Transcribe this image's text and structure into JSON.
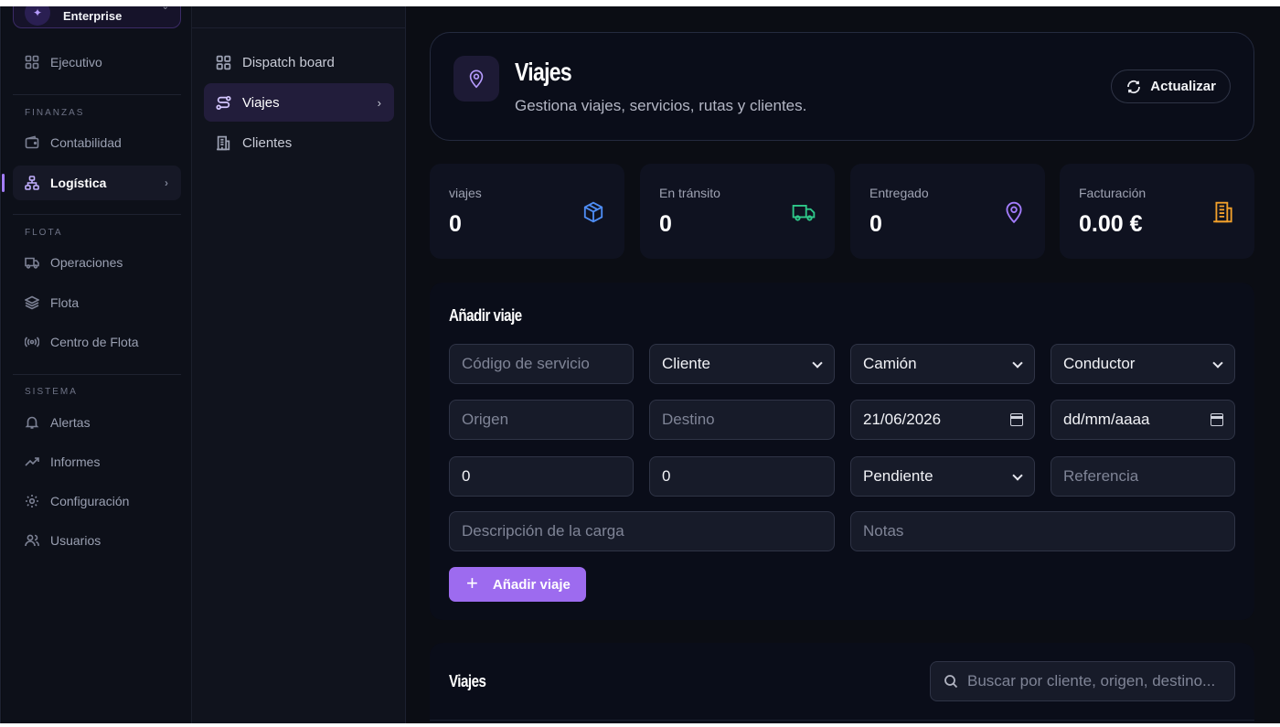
{
  "sidebar": {
    "org_name": "Enterprise",
    "items": {
      "ejecutivo": "Ejecutivo",
      "contabilidad": "Contabilidad",
      "logistica": "Logística",
      "operaciones": "Operaciones",
      "flota": "Flota",
      "centro_flota": "Centro de Flota",
      "alertas": "Alertas",
      "informes": "Informes",
      "configuracion": "Configuración",
      "usuarios": "Usuarios"
    },
    "sections": {
      "finanzas": "FINANZAS",
      "flota": "FLOTA",
      "sistema": "SISTEMA"
    }
  },
  "subnav": {
    "dispatch": "Dispatch board",
    "viajes": "Viajes",
    "clientes": "Clientes"
  },
  "header": {
    "title": "Viajes",
    "subtitle": "Gestiona viajes, servicios, rutas y clientes.",
    "refresh_label": "Actualizar"
  },
  "stats": [
    {
      "label": "viajes",
      "value": "0",
      "icon": "box-icon",
      "color": "#4e8df5"
    },
    {
      "label": "En tránsito",
      "value": "0",
      "icon": "truck-icon",
      "color": "#2fc98a"
    },
    {
      "label": "Entregado",
      "value": "0",
      "icon": "map-pin-icon",
      "color": "#a47dff"
    },
    {
      "label": "Facturación",
      "value": "0.00 €",
      "icon": "building-icon",
      "color": "#f3a12b"
    }
  ],
  "form": {
    "title": "Añadir viaje",
    "service_code_placeholder": "Código de servicio",
    "client_select": "Cliente",
    "truck_select": "Camión",
    "driver_select": "Conductor",
    "origin_placeholder": "Origen",
    "destination_placeholder": "Destino",
    "date_start": "21/06/2026",
    "date_end_placeholder": "dd/mm/aaaa",
    "amount_1": "0",
    "amount_2": "0",
    "status_select": "Pendiente",
    "reference_placeholder": "Referencia",
    "cargo_placeholder": "Descripción de la carga",
    "notes_placeholder": "Notas",
    "submit_label": "Añadir viaje"
  },
  "list": {
    "title": "Viajes",
    "search_placeholder": "Buscar por cliente, origen, destino..."
  },
  "colors": {
    "accent": "#9d6bef",
    "background": "#0b0d14"
  }
}
